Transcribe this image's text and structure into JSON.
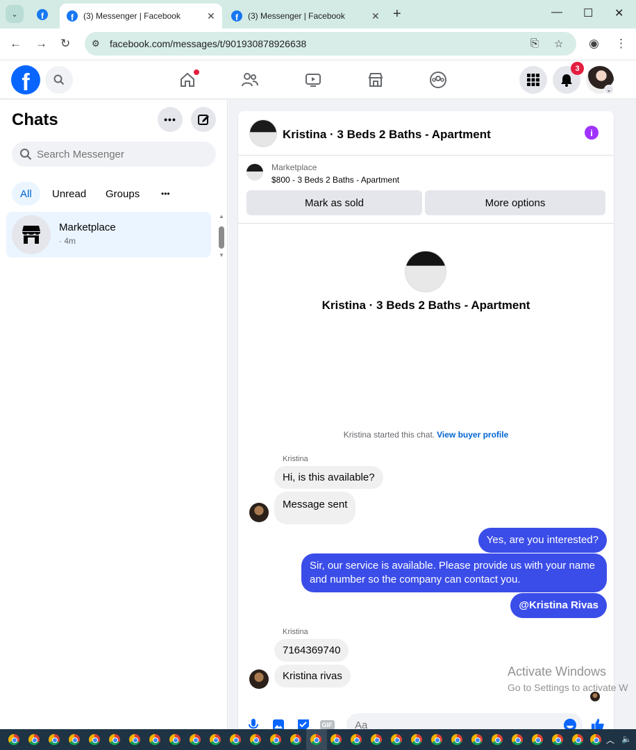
{
  "browser": {
    "tabs": [
      {
        "title": "(3) Messenger | Facebook",
        "active": true
      },
      {
        "title": "(3) Messenger | Facebook",
        "active": false
      }
    ],
    "url": "facebook.com/messages/t/901930878926638"
  },
  "fb_header": {
    "logo": "f",
    "notifications_count": "3"
  },
  "sidebar": {
    "title": "Chats",
    "search_placeholder": "Search Messenger",
    "filters": [
      "All",
      "Unread",
      "Groups",
      "•••"
    ],
    "chats": [
      {
        "name": "Marketplace",
        "time": "· 4m"
      }
    ]
  },
  "conversation": {
    "title": "Kristina · 3 Beds 2 Baths - Apartment",
    "marketplace_label": "Marketplace",
    "listing": "$800 - 3 Beds 2 Baths - Apartment",
    "mark_sold": "Mark as sold",
    "more_options": "More options",
    "intro_name": "Kristina · 3 Beds 2 Baths - Apartment",
    "started_text": "Kristina started this chat.",
    "started_link": "View buyer profile",
    "messages": [
      {
        "sender": "Kristina",
        "text": "Hi, is this available?",
        "direction": "in"
      },
      {
        "sender": "Kristina",
        "text": "Message sent",
        "direction": "in"
      },
      {
        "sender": "me",
        "text": "Yes, are you interested?",
        "direction": "out"
      },
      {
        "sender": "me",
        "text": "Sir, our service is available. Please provide us with your name and number so the company can contact you.",
        "direction": "out"
      },
      {
        "sender": "me",
        "text": "@Kristina Rivas",
        "direction": "out"
      },
      {
        "sender": "Kristina",
        "text": "7164369740",
        "direction": "in"
      },
      {
        "sender": "Kristina",
        "text": "Kristina rivas",
        "direction": "in"
      }
    ],
    "composer_placeholder": "Aa",
    "gif_label": "GIF"
  },
  "watermark": {
    "line1": "Activate Windows",
    "line2": "Go to Settings to activate W"
  },
  "colors": {
    "fb_blue": "#0866ff",
    "outgoing_bubble": "#3b4de8",
    "incoming_bubble": "#f0f0f0",
    "link": "#0064d1",
    "badge_red": "#e41e3f"
  }
}
